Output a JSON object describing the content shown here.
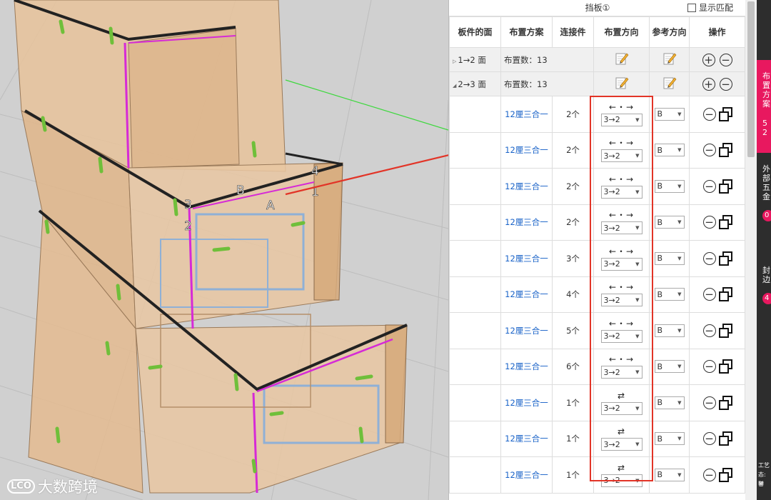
{
  "viewport": {
    "labels": {
      "n1": "1",
      "n2": "2",
      "n3": "3",
      "n4": "4",
      "a": "A",
      "b": "B"
    },
    "watermark": {
      "logo": "LCO",
      "text": "大数跨境"
    }
  },
  "panel": {
    "title": "挡板①",
    "match_label": "显示匹配",
    "headers": {
      "face": "板件的面",
      "plan": "布置方案",
      "connector": "连接件",
      "dir": "布置方向",
      "ref": "参考方向",
      "ops": "操作"
    },
    "groups": [
      {
        "face": "1→2 面",
        "count": "布置数：13",
        "expanded": false
      },
      {
        "face": "2→3 面",
        "count": "布置数：13",
        "expanded": true
      }
    ],
    "rows": [
      {
        "plan": "12厘三合一",
        "qty": "2个",
        "arrow": "←・→",
        "dir": "3→2",
        "ref": "B"
      },
      {
        "plan": "12厘三合一",
        "qty": "2个",
        "arrow": "←・→",
        "dir": "3→2",
        "ref": "B"
      },
      {
        "plan": "12厘三合一",
        "qty": "2个",
        "arrow": "←・→",
        "dir": "3→2",
        "ref": "B"
      },
      {
        "plan": "12厘三合一",
        "qty": "2个",
        "arrow": "←・→",
        "dir": "3→2",
        "ref": "B"
      },
      {
        "plan": "12厘三合一",
        "qty": "3个",
        "arrow": "←・→",
        "dir": "3→2",
        "ref": "B"
      },
      {
        "plan": "12厘三合一",
        "qty": "4个",
        "arrow": "←・→",
        "dir": "3→2",
        "ref": "B"
      },
      {
        "plan": "12厘三合一",
        "qty": "5个",
        "arrow": "←・→",
        "dir": "3→2",
        "ref": "B"
      },
      {
        "plan": "12厘三合一",
        "qty": "6个",
        "arrow": "←・→",
        "dir": "3→2",
        "ref": "B"
      },
      {
        "plan": "12厘三合一",
        "qty": "1个",
        "arrow": "⇄",
        "dir": "3→2",
        "ref": "B"
      },
      {
        "plan": "12厘三合一",
        "qty": "1个",
        "arrow": "⇄",
        "dir": "3→2",
        "ref": "B"
      },
      {
        "plan": "12厘三合一",
        "qty": "1个",
        "arrow": "⇄",
        "dir": "3→2",
        "ref": "B"
      }
    ]
  },
  "side_strip": {
    "t1": "布置方案",
    "n1": "52",
    "t2": "外部五金",
    "b2": "0",
    "t3": "封边",
    "b3": "4",
    "t4": "工艺",
    "t5": "态: 智",
    "t6": "举"
  },
  "colors": {
    "highlight": "#e23427",
    "link": "#1a63c8",
    "accent": "#e8185f",
    "magenta": "#d62ad6",
    "cabinet": "#e8c39b"
  }
}
